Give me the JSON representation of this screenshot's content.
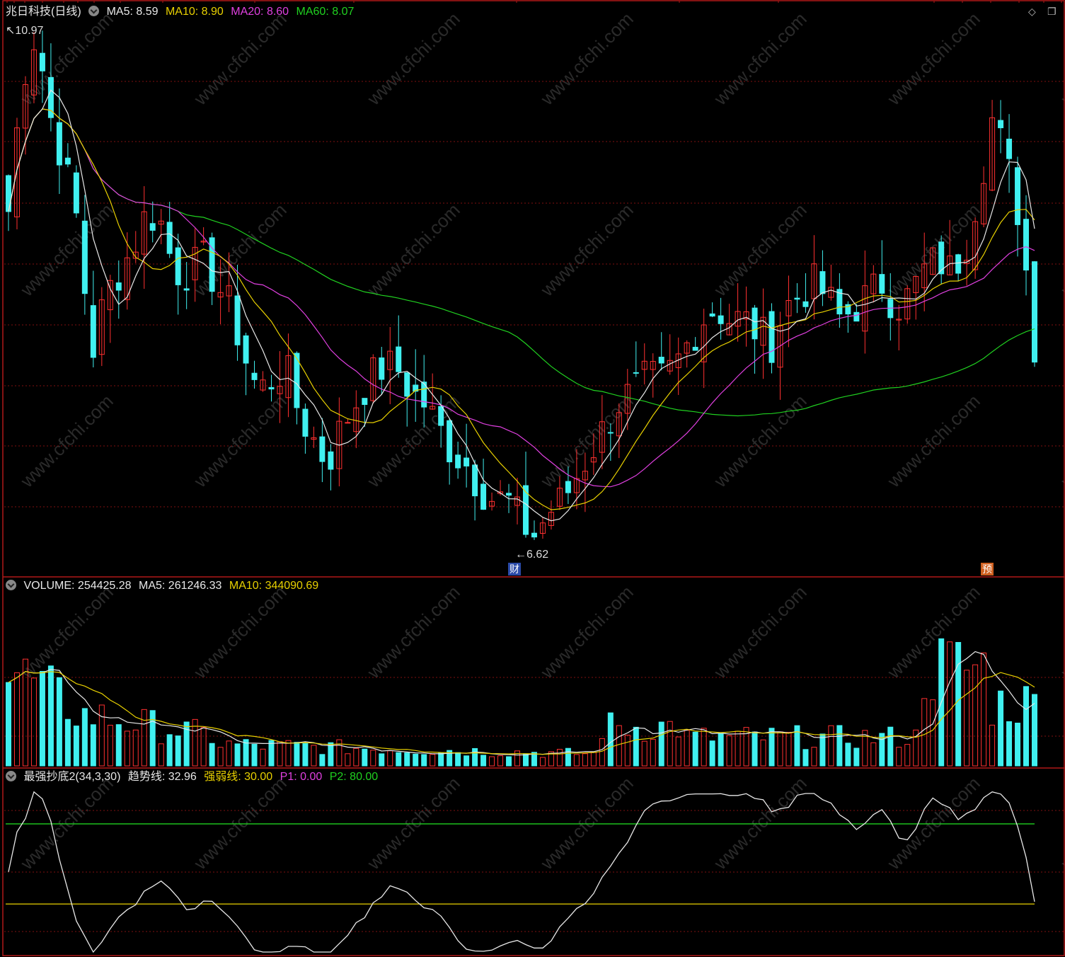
{
  "window": {
    "title": "兆日科技(日线)",
    "diamond_icon": "◇",
    "restore_icon": "❐"
  },
  "price_panel": {
    "legend": [
      {
        "label": "MA5: 8.59",
        "color": "#e8e8e8"
      },
      {
        "label": "MA10: 8.90",
        "color": "#e8d000"
      },
      {
        "label": "MA20: 8.60",
        "color": "#e040e0"
      },
      {
        "label": "MA60: 8.07",
        "color": "#20d020"
      }
    ],
    "high_label": "10.97",
    "low_label": "←6.62",
    "tag_cai": "财",
    "tag_yu": "预"
  },
  "volume_panel": {
    "name": "VOLUME: 254425.28",
    "ma5": "MA5: 261246.33",
    "ma10": "MA10: 344090.69"
  },
  "indicator_panel": {
    "name": "最强抄底2(34,3,30)",
    "trend": "趋势线: 32.96",
    "strong_weak": "强弱线: 30.00",
    "p1": "P1: 0.00",
    "p2": "P2: 80.00"
  },
  "colors": {
    "up": "#ff3030",
    "down": "#40f0f0",
    "ma5": "#e8e8e8",
    "ma10": "#e8d000",
    "ma20": "#e040e0",
    "ma60": "#20d020",
    "border": "#b01818",
    "grid": "#801010"
  },
  "watermark": "www.cfchi.com",
  "chart_data": {
    "type": "candlestick",
    "ohlc_close_sketch": [
      9.4,
      10.5,
      10.9,
      10.2,
      9.8,
      9.3,
      8.2,
      8.7,
      8.9,
      9.1,
      9.4,
      9.3,
      8.9,
      8.9,
      9.0,
      8.8,
      8.6,
      8.2,
      7.9,
      8.0,
      8.1,
      7.7,
      7.5,
      7.3,
      7.6,
      7.8,
      8.0,
      8.1,
      8.1,
      7.9,
      7.8,
      7.6,
      7.4,
      7.3,
      7.1,
      7.0,
      7.0,
      6.8,
      6.7,
      6.9,
      7.0,
      7.2,
      7.4,
      7.6,
      7.8,
      7.9,
      8.0,
      8.0,
      8.1,
      8.3,
      8.5,
      8.6,
      8.5,
      8.5,
      8.4,
      8.3,
      8.6,
      8.7,
      8.8,
      8.7,
      8.5,
      8.6,
      8.7,
      8.8,
      8.6,
      8.7,
      8.9,
      9.0,
      8.9,
      9.1,
      9.6,
      10.2,
      9.8,
      9.3,
      8.3
    ],
    "price_high": 10.97,
    "price_low": 6.62
  }
}
